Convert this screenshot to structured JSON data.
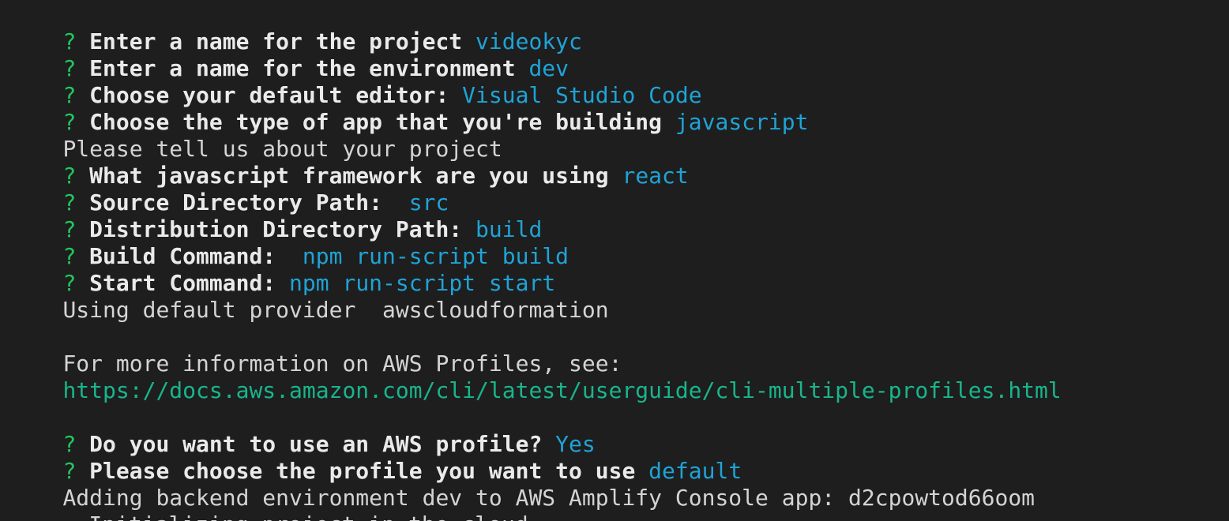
{
  "window": {
    "kind": "terminal",
    "background": "#1e1e1e"
  },
  "colors": {
    "question_mark": "#22c55e",
    "answer": "#1fa3d6",
    "link": "#19b58a",
    "plain": "#d4d4d4",
    "bold": "#eaeaea"
  },
  "lines": {
    "l1": {
      "q": "?",
      "prompt": "Enter a name for the project",
      "answer": "videokyc"
    },
    "l2": {
      "q": "?",
      "prompt": "Enter a name for the environment",
      "answer": "dev"
    },
    "l3": {
      "q": "?",
      "prompt": "Choose your default editor:",
      "answer": "Visual Studio Code"
    },
    "l4": {
      "q": "?",
      "prompt": "Choose the type of app that you're building",
      "answer": "javascript"
    },
    "l5": {
      "text": "Please tell us about your project"
    },
    "l6": {
      "q": "?",
      "prompt": "What javascript framework are you using",
      "answer": "react"
    },
    "l7": {
      "q": "?",
      "prompt": "Source Directory Path: ",
      "answer": "src"
    },
    "l8": {
      "q": "?",
      "prompt": "Distribution Directory Path:",
      "answer": "build"
    },
    "l9": {
      "q": "?",
      "prompt": "Build Command: ",
      "answer": "npm run-script build"
    },
    "l10": {
      "q": "?",
      "prompt": "Start Command:",
      "answer": "npm run-script start"
    },
    "l11": {
      "text": "Using default provider  awscloudformation"
    },
    "l13": {
      "text": "For more information on AWS Profiles, see:"
    },
    "l14": {
      "link": "https://docs.aws.amazon.com/cli/latest/userguide/cli-multiple-profiles.html"
    },
    "l16": {
      "q": "?",
      "prompt": "Do you want to use an AWS profile?",
      "answer": "Yes"
    },
    "l17": {
      "q": "?",
      "prompt": "Please choose the profile you want to use",
      "answer": "default"
    },
    "l18": {
      "text": "Adding backend environment dev to AWS Amplify Console app: d2cpowtod66oom"
    },
    "l19": {
      "spinner": "⠴",
      "text": "Initializing project in the cloud..."
    }
  }
}
